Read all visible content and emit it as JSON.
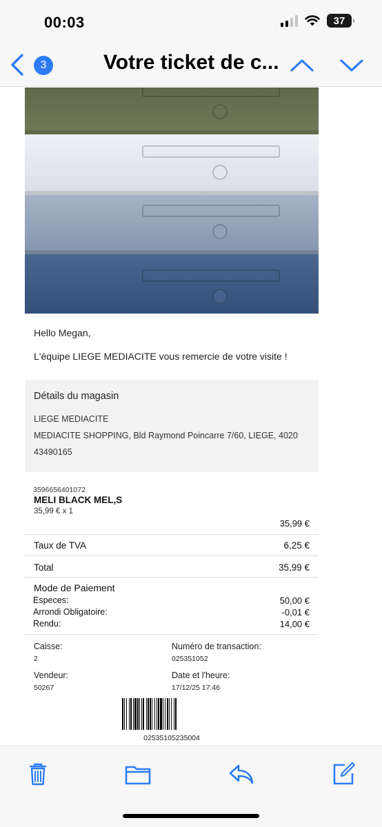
{
  "status_bar": {
    "time": "00:03",
    "battery": "37"
  },
  "nav": {
    "back_icon": "chevron-left-icon",
    "unread_count": "3",
    "title": "Votre ticket de c...",
    "prev_icon": "chevron-up-icon",
    "next_icon": "chevron-down-icon"
  },
  "email": {
    "greeting": "Hello Megan,",
    "thanks": "L'équipe LIEGE MEDIACITE vous remercie de votre visite !",
    "store": {
      "title": "Détails du magasin",
      "name": "LIEGE MEDIACITE",
      "address": "MEDIACITE SHOPPING, Bld Raymond Poincarre 7/60, LIEGE, 4020",
      "phone": "43490165"
    },
    "item": {
      "sku": "3596656401072",
      "name": "MELI BLACK MEL,S",
      "qty_price": "35,99 € x 1",
      "price": "35,99 €"
    },
    "vat": {
      "label": "Taux de TVA",
      "value": "6,25 €"
    },
    "total": {
      "label": "Total",
      "value": "35,99 €"
    },
    "payment": {
      "title": "Mode de Paiement",
      "rows": [
        {
          "label": "Especes:",
          "value": "50,00 €"
        },
        {
          "label": "Arrondi Obligatoire:",
          "value": "-0,01 €"
        },
        {
          "label": "Rendu:",
          "value": "14,00 €"
        }
      ]
    },
    "meta": {
      "register_label": "Caisse:",
      "register_value": "2",
      "transaction_label": "Numéro de transaction:",
      "transaction_value": "025351052",
      "seller_label": "Vendeur:",
      "seller_value": "50267",
      "datetime_label": "Date et l'heure:",
      "datetime_value": "17/12/25 17:46"
    },
    "barcode_number": "02535105235004"
  },
  "toolbar": {
    "items": [
      "trash-icon",
      "folder-icon",
      "reply-icon",
      "compose-icon"
    ]
  },
  "colors": {
    "accent": "#2d7cf6",
    "bar_bg": "#f7f7f7",
    "store_box_bg": "#f2f2f2",
    "hero_green": "#6c7453",
    "hero_white": "#e4e8ee",
    "hero_light_blue": "#8d9db6",
    "hero_dark_blue": "#3f5b86"
  }
}
